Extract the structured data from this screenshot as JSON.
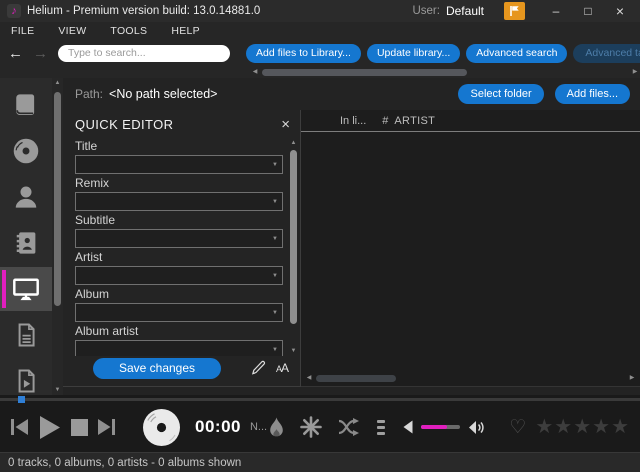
{
  "titlebar": {
    "app_title": "Helium - Premium version build: 13.0.14881.0",
    "note_glyph": "♪",
    "user_label": "User:",
    "user_name": "Default",
    "minimize_glyph": "–",
    "maximize_glyph": "□",
    "close_glyph": "×"
  },
  "menubar": {
    "items": [
      "FILE",
      "VIEW",
      "TOOLS",
      "HELP"
    ]
  },
  "toolbar": {
    "back_glyph": "←",
    "forward_glyph": "→",
    "search_placeholder": "Type to search...",
    "search_value": "",
    "buttons": [
      {
        "label": "Add files to Library...",
        "enabled": true
      },
      {
        "label": "Update library...",
        "enabled": true
      },
      {
        "label": "Advanced search",
        "enabled": true
      },
      {
        "label": "Advanced tag editor...",
        "enabled": false
      }
    ]
  },
  "pathbar": {
    "label": "Path:",
    "value": "<No path selected>",
    "select_folder_label": "Select folder",
    "add_files_label": "Add files..."
  },
  "sidebar": {
    "selected_index": 4,
    "items": [
      {
        "icon": "book-icon"
      },
      {
        "icon": "disc-icon"
      },
      {
        "icon": "artist-icon"
      },
      {
        "icon": "contacts-icon"
      },
      {
        "icon": "monitor-icon"
      },
      {
        "icon": "document-icon"
      },
      {
        "icon": "video-playlist-icon"
      }
    ]
  },
  "quick_editor": {
    "title": "QUICK EDITOR",
    "close_glyph": "×",
    "fields": [
      {
        "label": "Title",
        "value": ""
      },
      {
        "label": "Remix",
        "value": ""
      },
      {
        "label": "Subtitle",
        "value": ""
      },
      {
        "label": "Artist",
        "value": ""
      },
      {
        "label": "Album",
        "value": ""
      },
      {
        "label": "Album artist",
        "value": ""
      }
    ],
    "combo_arrow_glyph": "▼",
    "save_button_label": "Save changes",
    "font_size_label": "AA"
  },
  "library_table": {
    "columns": [
      "In li...",
      "#",
      "ARTIST"
    ],
    "rows": []
  },
  "player": {
    "time": "00:00",
    "now_playing_abbrev": "N...",
    "volume_percent": 65,
    "heart_glyph": "♡",
    "star_glyph": "★",
    "rating_count": 5
  },
  "statusbar": {
    "text": "0 tracks, 0 albums, 0 artists - 0 albums shown"
  },
  "scroll_glyphs": {
    "up": "▲",
    "down": "▼",
    "left": "◀",
    "right": "▶"
  },
  "colors": {
    "accent_pink": "#e01fbe",
    "button_blue": "#1577d0",
    "button_blue_disabled": "#1c3e5c",
    "flag_orange": "#e6961e",
    "progress_knob_blue": "#2f7fd6"
  }
}
